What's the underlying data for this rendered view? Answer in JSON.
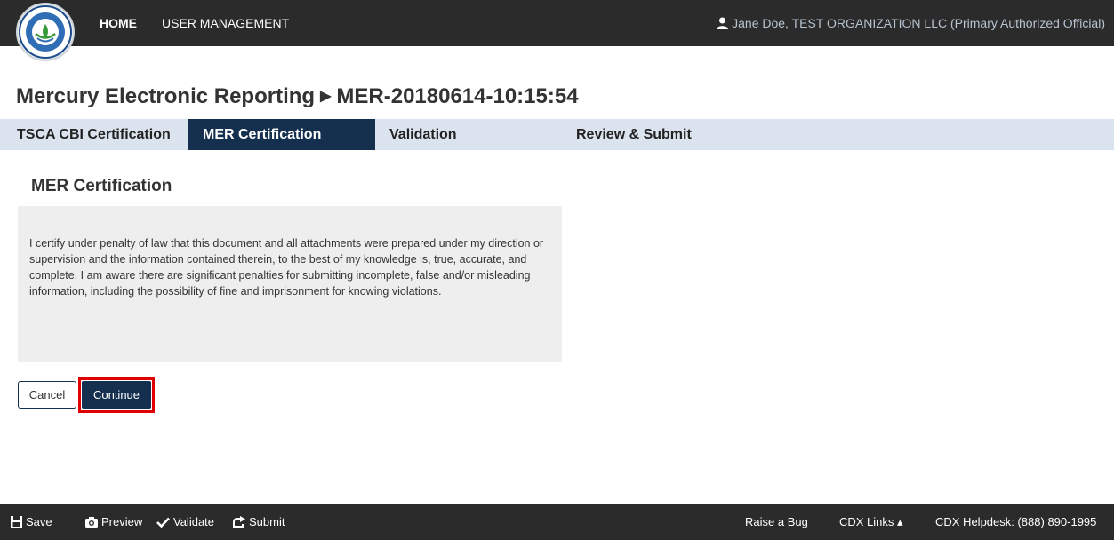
{
  "header": {
    "nav": {
      "home": "HOME",
      "user_management": "USER MANAGEMENT"
    },
    "user": "Jane Doe, TEST ORGANIZATION LLC (Primary Authorized Official)",
    "logo_icon": "epa-seal-icon",
    "user_icon": "user-icon"
  },
  "page": {
    "title_main": "Mercury Electronic Reporting",
    "title_separator": "▶",
    "title_id": "MER-20180614-10:15:54"
  },
  "tabs": [
    {
      "label": "TSCA CBI Certification",
      "active": false
    },
    {
      "label": "MER Certification",
      "active": true
    },
    {
      "label": "Validation",
      "active": false
    },
    {
      "label": "Review & Submit",
      "active": false
    }
  ],
  "section": {
    "title": "MER Certification",
    "certification_text": "I certify under penalty of law that this document and all attachments were prepared under my direction or supervision and the information contained therein, to the best of my knowledge is, true, accurate, and complete. I am aware there are significant penalties for submitting incomplete, false and/or misleading information, including the possibility of fine and imprisonment for knowing violations."
  },
  "buttons": {
    "cancel": "Cancel",
    "continue": "Continue"
  },
  "footer": {
    "save": "Save",
    "preview": "Preview",
    "validate": "Validate",
    "submit": "Submit",
    "raise_bug": "Raise a Bug",
    "cdx_links": "CDX Links ▴",
    "helpdesk": "CDX Helpdesk: (888) 890-1995"
  },
  "colors": {
    "topbar": "#2b2b2b",
    "active_tab": "#15304f",
    "tab_strip": "#dbe4ee",
    "highlight": "#e10000"
  }
}
